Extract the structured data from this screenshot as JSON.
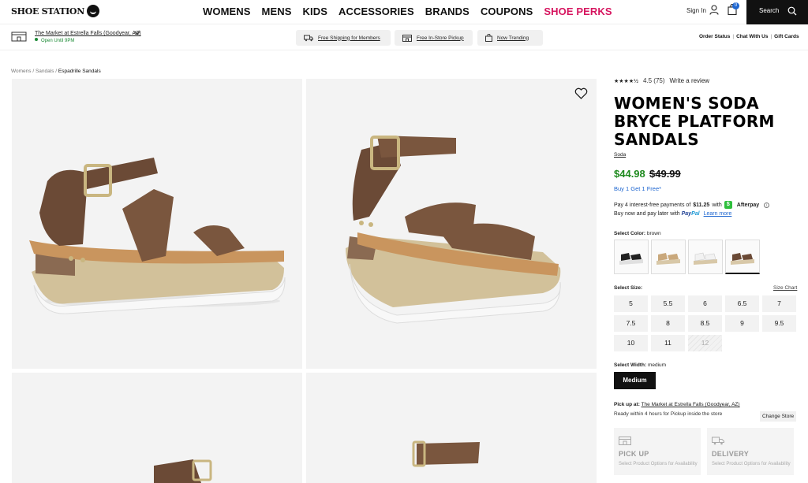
{
  "header": {
    "logo": "SHOE STATION",
    "nav": [
      "WOMENS",
      "MENS",
      "KIDS",
      "ACCESSORIES",
      "BRANDS",
      "COUPONS",
      "SHOE PERKS"
    ],
    "sign_in": "Sign In",
    "cart_count": "0",
    "search_label": "Search"
  },
  "subheader": {
    "store_name": "The Market at Estrella Falls (Goodyear, AZ)",
    "store_status": "Open Until 9PM",
    "perks": [
      "Free Shipping for Members",
      "Free In-Store Pickup",
      "Now Trending"
    ],
    "utility_links": [
      "Order Status",
      "Chat With Us",
      "Gift Cards"
    ]
  },
  "breadcrumb": [
    "Womens",
    "Sandals",
    "Espadrille Sandals"
  ],
  "product": {
    "rating_stars": "★★★★½",
    "rating_text": "4.5 (75)",
    "write_review": "Write a review",
    "title": "WOMEN'S SODA BRYCE PLATFORM SANDALS",
    "brand": "Soda",
    "sale_price": "$44.98",
    "original_price": "$49.99",
    "promo": "Buy 1 Get 1 Free*",
    "afterpay_prefix": "Pay 4 interest-free payments of",
    "afterpay_amount": "$11.25",
    "afterpay_with": "with",
    "afterpay_brand": "Afterpay",
    "paypal_text": "Buy now and pay later with",
    "paypal_brand_a": "Pay",
    "paypal_brand_b": "Pal",
    "paypal_learn": "Learn more",
    "select_color_label": "Select Color:",
    "selected_color": "brown",
    "select_size_label": "Select Size:",
    "size_chart": "Size Chart",
    "sizes": [
      "5",
      "5.5",
      "6",
      "6.5",
      "7",
      "7.5",
      "8",
      "8.5",
      "9",
      "9.5",
      "10",
      "11",
      "12"
    ],
    "select_width_label": "Select Width:",
    "selected_width": "medium",
    "width_button": "Medium",
    "pickup_label": "Pick up at:",
    "pickup_store": "The Market at Estrella Falls (Goodyear, AZ)",
    "ready_text": "Ready within 4 hours for Pickup inside the store",
    "change_store": "Change Store",
    "pickup_card_title": "PICK UP",
    "pickup_card_desc": "Select Product Options for Availability",
    "delivery_card_title": "DELIVERY",
    "delivery_card_desc": "Select Product Options for Availability"
  },
  "colors": {
    "accent_pink": "#d6155f",
    "sale_green": "#1e8a1e",
    "link_blue": "#1e66d0"
  }
}
